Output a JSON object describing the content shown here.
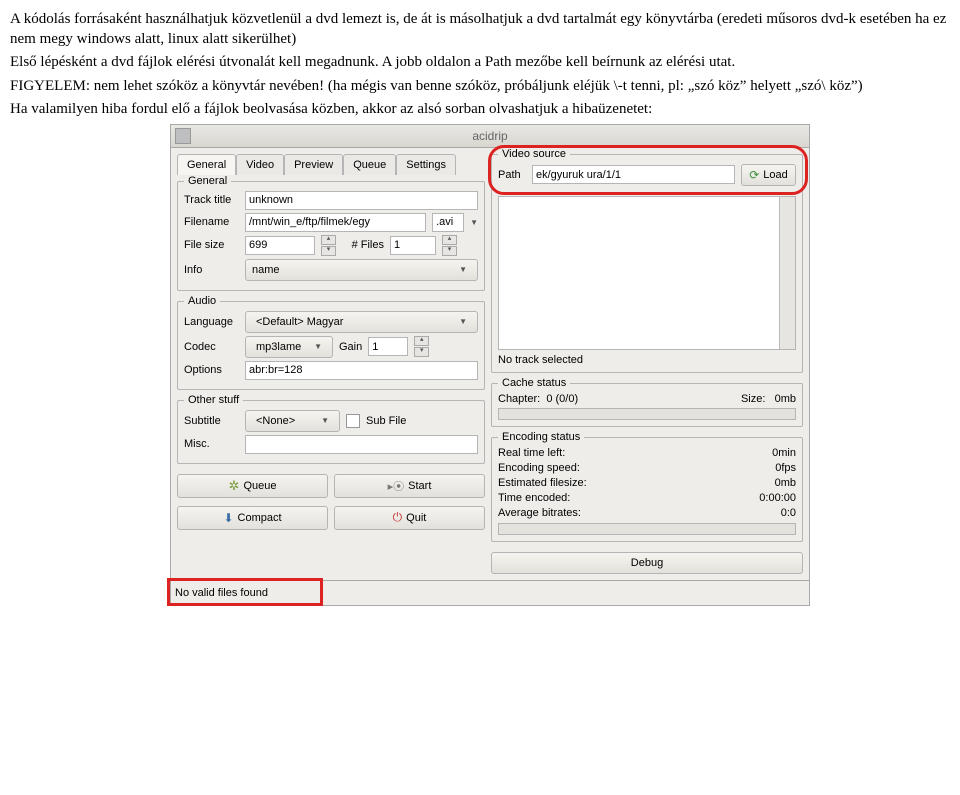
{
  "doc": {
    "p1": "A kódolás forrásaként használhatjuk közvetlenül a dvd lemezt is, de át is másolhatjuk a dvd tartalmát egy könyvtárba (eredeti műsoros dvd-k esetében ha ez nem megy windows alatt, linux alatt sikerülhet)",
    "p2": "Első lépésként a dvd fájlok elérési útvonalát kell megadnunk. A jobb oldalon a Path mezőbe kell beírnunk az elérési utat.",
    "p3": "FIGYELEM: nem lehet szóköz a könyvtár nevében! (ha mégis van benne szóköz, próbáljunk eléjük \\-t tenni, pl: „szó köz” helyett „szó\\ köz”)",
    "p4": "Ha valamilyen hiba fordul elő a fájlok beolvasása közben, akkor az alsó sorban olvashatjuk a hibaüzenetet:"
  },
  "app": {
    "title": "acidrip",
    "tabs": [
      "General",
      "Video",
      "Preview",
      "Queue",
      "Settings"
    ],
    "general": {
      "pane_title": "General",
      "track_title_label": "Track title",
      "track_title": "unknown",
      "filename_label": "Filename",
      "filename": "/mnt/win_e/ftp/filmek/egy",
      "ext": ".avi",
      "filesize_label": "File size",
      "filesize": "699",
      "numfiles_label": "# Files",
      "numfiles": "1",
      "info_label": "Info",
      "info_btn": "name"
    },
    "audio": {
      "pane_title": "Audio",
      "lang_label": "Language",
      "lang": "<Default> Magyar",
      "codec_label": "Codec",
      "codec": "mp3lame",
      "gain_label": "Gain",
      "gain": "1",
      "options_label": "Options",
      "options": "abr:br=128"
    },
    "other": {
      "pane_title": "Other stuff",
      "subtitle_label": "Subtitle",
      "subtitle": "<None>",
      "subfile": "Sub File",
      "misc_label": "Misc."
    },
    "source": {
      "pane_title": "Video source",
      "path_label": "Path",
      "path": "ek/gyuruk ura/1/1",
      "load": "Load"
    },
    "no_track": "No track selected",
    "cache": {
      "title": "Cache status",
      "chapter_label": "Chapter:",
      "chapter_val": "0 (0/0)",
      "size_label": "Size:",
      "size_val": "0mb"
    },
    "enc": {
      "title": "Encoding status",
      "rt_label": "Real time left:",
      "rt": "0min",
      "es_label": "Encoding speed:",
      "es": "0fps",
      "ef_label": "Estimated filesize:",
      "ef": "0mb",
      "te_label": "Time encoded:",
      "te": "0:00:00",
      "ab_label": "Average bitrates:",
      "ab": "0:0"
    },
    "buttons": {
      "queue": "Queue",
      "start": "Start",
      "compact": "Compact",
      "quit": "Quit",
      "debug": "Debug"
    },
    "status": "No valid files found"
  }
}
